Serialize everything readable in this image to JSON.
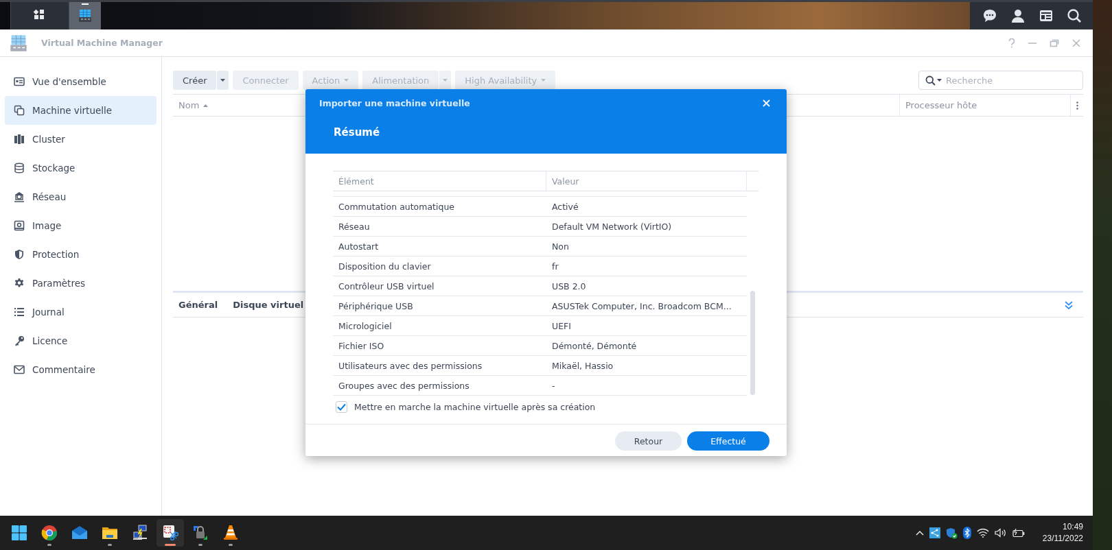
{
  "desktop_bar": {
    "launchers": [
      {
        "kind": "main-menu",
        "selected": false
      },
      {
        "kind": "vmm",
        "selected": true
      }
    ]
  },
  "window": {
    "title": "Virtual Machine Manager"
  },
  "sidebar": {
    "items": [
      {
        "label": "Vue d'ensemble",
        "selected": false
      },
      {
        "label": "Machine virtuelle",
        "selected": true
      },
      {
        "label": "Cluster",
        "selected": false
      },
      {
        "label": "Stockage",
        "selected": false
      },
      {
        "label": "Réseau",
        "selected": false
      },
      {
        "label": "Image",
        "selected": false
      },
      {
        "label": "Protection",
        "selected": false
      },
      {
        "label": "Paramètres",
        "selected": false
      },
      {
        "label": "Journal",
        "selected": false
      },
      {
        "label": "Licence",
        "selected": false
      },
      {
        "label": "Commentaire",
        "selected": false
      }
    ]
  },
  "toolbar": {
    "buttons": [
      {
        "label": "Créer",
        "kind": "split",
        "disabled": false
      },
      {
        "label": "Connecter",
        "kind": "plain",
        "disabled": true
      },
      {
        "label": "Action",
        "kind": "dropdown",
        "disabled": true
      },
      {
        "label": "Alimentation",
        "kind": "split",
        "disabled": true
      },
      {
        "label": "High Availability",
        "kind": "dropdown",
        "disabled": true
      }
    ]
  },
  "search": {
    "placeholder": "Recherche"
  },
  "table": {
    "columns": [
      {
        "label": "Nom",
        "sorted": true
      },
      {
        "label": "Processeur hôte",
        "sorted": false
      }
    ]
  },
  "detail_tabs": [
    {
      "label": "Général"
    },
    {
      "label": "Disque virtuel"
    }
  ],
  "dialog": {
    "title": "Importer une machine virtuelle",
    "step": "Résumé",
    "columns": [
      "Élément",
      "Valeur"
    ],
    "rows": [
      [
        "Commutation automatique",
        "Activé"
      ],
      [
        "Réseau",
        "Default VM Network (VirtIO)"
      ],
      [
        "Autostart",
        "Non"
      ],
      [
        "Disposition du clavier",
        "fr"
      ],
      [
        "Contrôleur USB virtuel",
        "USB 2.0"
      ],
      [
        "Périphérique USB",
        "ASUSTek Computer, Inc. Broadcom BCM..."
      ],
      [
        "Micrologiciel",
        "UEFI"
      ],
      [
        "Fichier ISO",
        "Démonté, Démonté"
      ],
      [
        "Utilisateurs avec des permissions",
        "Mikaël, Hassio"
      ],
      [
        "Groupes avec des permissions",
        "-"
      ]
    ],
    "start_after_creation": {
      "label": "Mettre en marche la machine virtuelle après sa création",
      "checked": true
    },
    "buttons": [
      {
        "label": "Retour",
        "kind": "secondary"
      },
      {
        "label": "Effectué",
        "kind": "primary"
      }
    ]
  },
  "taskbar": {
    "apps": [
      {
        "kind": "start",
        "running": false,
        "selected": false
      },
      {
        "kind": "chrome",
        "running": true,
        "selected": false
      },
      {
        "kind": "mail",
        "running": false,
        "selected": false
      },
      {
        "kind": "folder",
        "running": true,
        "selected": false
      },
      {
        "kind": "network",
        "running": false,
        "selected": false
      },
      {
        "kind": "snipping",
        "running": true,
        "selected": true
      },
      {
        "kind": "lock",
        "running": true,
        "selected": false
      },
      {
        "kind": "cone",
        "running": true,
        "selected": false
      }
    ],
    "time": "10:49",
    "date": "23/11/2022"
  }
}
